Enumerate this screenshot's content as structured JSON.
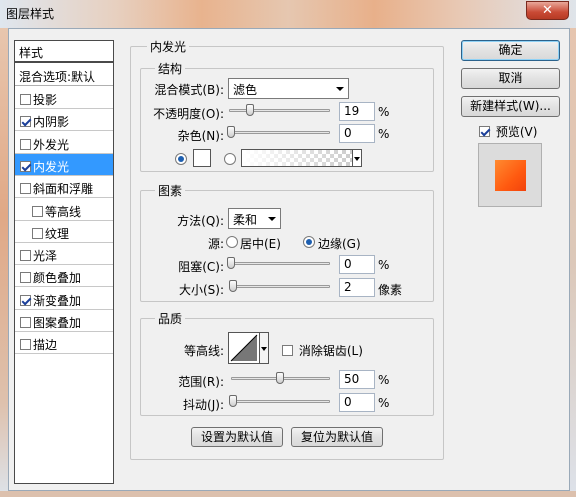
{
  "window": {
    "title": "图层样式",
    "close": "✕"
  },
  "sidebar": {
    "header": "样式",
    "blend_options": "混合选项:默认",
    "items": [
      {
        "label": "投影",
        "checked": false
      },
      {
        "label": "内阴影",
        "checked": true
      },
      {
        "label": "外发光",
        "checked": false
      },
      {
        "label": "内发光",
        "checked": true,
        "selected": true
      },
      {
        "label": "斜面和浮雕",
        "checked": false
      },
      {
        "label": "等高线",
        "checked": false,
        "sub": true
      },
      {
        "label": "纹理",
        "checked": false,
        "sub": true
      },
      {
        "label": "光泽",
        "checked": false
      },
      {
        "label": "颜色叠加",
        "checked": false
      },
      {
        "label": "渐变叠加",
        "checked": true
      },
      {
        "label": "图案叠加",
        "checked": false
      },
      {
        "label": "描边",
        "checked": false
      }
    ]
  },
  "panel": {
    "title": "内发光",
    "structure": {
      "title": "结构",
      "blend_mode_label": "混合模式(B):",
      "blend_mode_value": "滤色",
      "opacity_label": "不透明度(O):",
      "opacity_value": "19",
      "opacity_unit": "%",
      "noise_label": "杂色(N):",
      "noise_value": "0",
      "noise_unit": "%"
    },
    "elements": {
      "title": "图素",
      "method_label": "方法(Q):",
      "method_value": "柔和",
      "source_label": "源:",
      "source_center": "居中(E)",
      "source_edge": "边缘(G)",
      "choke_label": "阻塞(C):",
      "choke_value": "0",
      "choke_unit": "%",
      "size_label": "大小(S):",
      "size_value": "2",
      "size_unit": "像素"
    },
    "quality": {
      "title": "品质",
      "contour_label": "等高线:",
      "antialias_label": "消除锯齿(L)",
      "range_label": "范围(R):",
      "range_value": "50",
      "range_unit": "%",
      "jitter_label": "抖动(J):",
      "jitter_value": "0",
      "jitter_unit": "%"
    },
    "set_default": "设置为默认值",
    "reset_default": "复位为默认值"
  },
  "buttons": {
    "ok": "确定",
    "cancel": "取消",
    "new_style": "新建样式(W)...",
    "preview_label": "预览(V)"
  },
  "colors": {
    "preview_swatch": "#ff5a10",
    "selection": "#3399ff"
  }
}
